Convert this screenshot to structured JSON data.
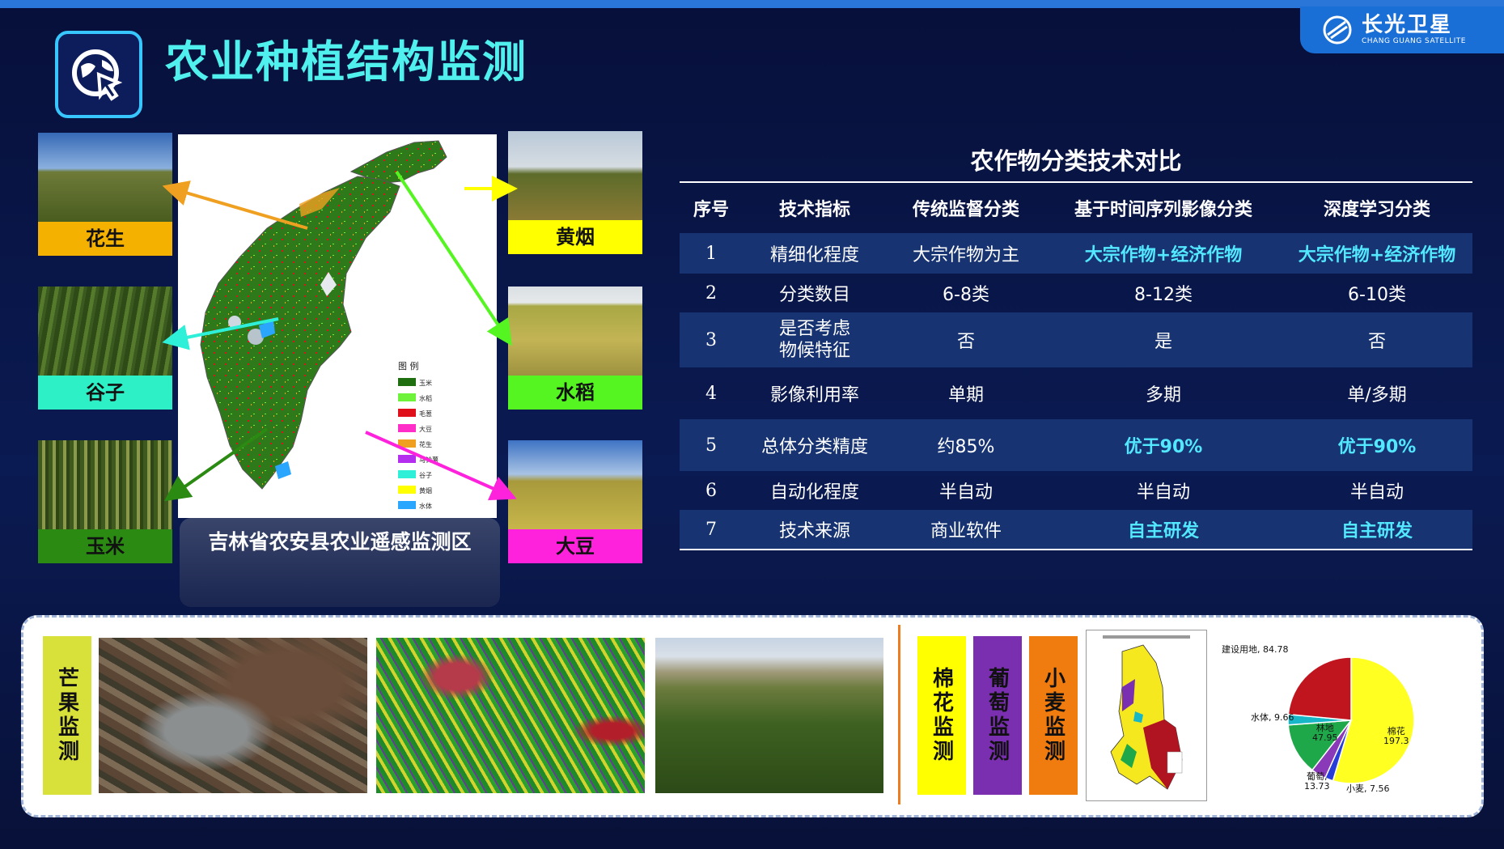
{
  "header": {
    "title": "农业种植结构监测",
    "logo_cn": "长光卫星",
    "logo_en": "CHANG GUANG SATELLITE"
  },
  "crops": [
    {
      "id": "peanut",
      "label": "花生",
      "color": "#f5b100"
    },
    {
      "id": "millet",
      "label": "谷子",
      "color": "#2ef0c7"
    },
    {
      "id": "corn",
      "label": "玉米",
      "color": "#1f7a10"
    },
    {
      "id": "tobacco",
      "label": "黄烟",
      "color": "#ffff00"
    },
    {
      "id": "rice",
      "label": "水稻",
      "color": "#55f522"
    },
    {
      "id": "soybean",
      "label": "大豆",
      "color": "#ff22dd"
    }
  ],
  "map": {
    "caption": "吉林省农安县农业遥感监测区",
    "legend_title": "图 例",
    "legend": [
      {
        "label": "玉米",
        "color": "#1f6e10"
      },
      {
        "label": "水稻",
        "color": "#6ef23a"
      },
      {
        "label": "毛葱",
        "color": "#e0101a"
      },
      {
        "label": "大豆",
        "color": "#ff2ec8"
      },
      {
        "label": "花生",
        "color": "#f0a020"
      },
      {
        "label": "马铃薯",
        "color": "#b52ef0"
      },
      {
        "label": "谷子",
        "color": "#2ef0d8"
      },
      {
        "label": "黄烟",
        "color": "#ffff00"
      },
      {
        "label": "水体",
        "color": "#2aa6ff"
      }
    ]
  },
  "table": {
    "title": "农作物分类技术对比",
    "headers": [
      "序号",
      "技术指标",
      "传统监督分类",
      "基于时间序列影像分类",
      "深度学习分类"
    ],
    "rows": [
      [
        "1",
        "精细化程度",
        "大宗作物为主",
        "大宗作物+经济作物",
        "大宗作物+经济作物"
      ],
      [
        "2",
        "分类数目",
        "6-8类",
        "8-12类",
        "6-10类"
      ],
      [
        "3",
        "是否考虑\n物候特征",
        "否",
        "是",
        "否"
      ],
      [
        "4",
        "影像利用率",
        "单期",
        "多期",
        "单/多期"
      ],
      [
        "5",
        "总体分类精度",
        "约85%",
        "优于90%",
        "优于90%"
      ],
      [
        "6",
        "自动化程度",
        "半自动",
        "半自动",
        "半自动"
      ],
      [
        "7",
        "技术来源",
        "商业软件",
        "自主研发",
        "自主研发"
      ]
    ]
  },
  "bottom": {
    "mango_label": "芒果监测",
    "monitor_labels": [
      {
        "label": "棉花监测",
        "color": "#ffff00"
      },
      {
        "label": "葡萄监测",
        "color": "#7a2fb0"
      },
      {
        "label": "小麦监测",
        "color": "#f07c10"
      }
    ],
    "pie": {
      "slices": [
        {
          "name": "棉花",
          "value": 197.3,
          "color": "#ffff22"
        },
        {
          "name": "小麦",
          "value": 7.56,
          "color": "#2a3cd8"
        },
        {
          "name": "葡萄",
          "value": 13.73,
          "color": "#8a3ab8"
        },
        {
          "name": "林地",
          "value": 47.95,
          "color": "#1fa84a"
        },
        {
          "name": "水体",
          "value": 9.66,
          "color": "#18b7c8"
        },
        {
          "name": "建设用地",
          "value": 84.78,
          "color": "#c0141e"
        }
      ],
      "labels": {
        "construction": "建设用地, 84.78",
        "water": "水体, 9.66",
        "forest_name": "林地",
        "forest_value": "47.95",
        "cotton_name": "棉花",
        "cotton_value": "197.3",
        "grape_name": "葡萄,",
        "grape_value": "13.73",
        "wheat": "小麦, 7.56"
      }
    }
  }
}
